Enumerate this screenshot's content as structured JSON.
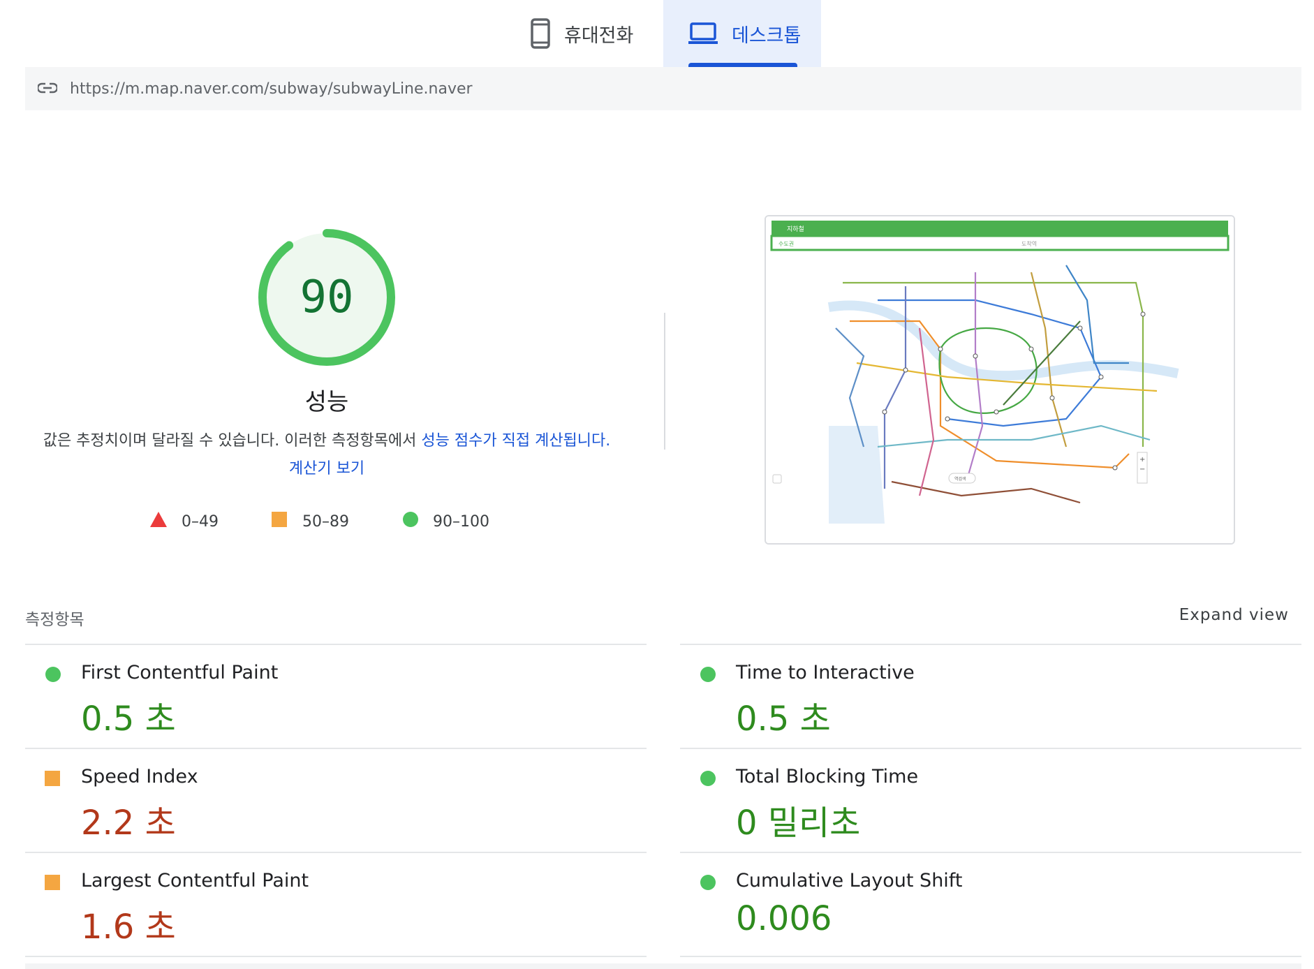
{
  "tabs": {
    "mobile_label": "휴대전화",
    "desktop_label": "데스크톱"
  },
  "url": "https://m.map.naver.com/subway/subwayLine.naver",
  "score": {
    "value": "90",
    "fraction": 0.9,
    "title": "성능"
  },
  "description": {
    "text": "값은 추정치이며 달라질 수 있습니다. 이러한 측정항목에서 ",
    "link1": "성능 점수가 직접 계산됩니다",
    "link1_display_end": ".",
    "link2": "계산기 보기"
  },
  "legend": [
    {
      "shape": "triangle",
      "color": "#eb3b3b",
      "label": "0–49"
    },
    {
      "shape": "square",
      "color": "#f4a641",
      "label": "50–89"
    },
    {
      "shape": "circle",
      "color": "#4cc45f",
      "label": "90–100"
    }
  ],
  "metrics": {
    "header": "측정항목",
    "expand_label": "Expand view",
    "left": [
      {
        "name": "First Contentful Paint",
        "value": "0.5 초",
        "status": "good"
      },
      {
        "name": "Speed Index",
        "value": "2.2 초",
        "status": "average"
      },
      {
        "name": "Largest Contentful Paint",
        "value": "1.6 초",
        "status": "average"
      }
    ],
    "right": [
      {
        "name": "Time to Interactive",
        "value": "0.5 초",
        "status": "good"
      },
      {
        "name": "Total Blocking Time",
        "value": "0 밀리초",
        "status": "good"
      },
      {
        "name": "Cumulative Layout Shift",
        "value": "0.006",
        "status": "good"
      }
    ]
  },
  "thumbnail": {
    "header_title": "지하철",
    "search_from": "수도권",
    "search_to": "도착역",
    "search_button": "역검색"
  },
  "colors": {
    "good": "#4cc45f",
    "average": "#f4a641",
    "accent": "#1a55d6"
  }
}
